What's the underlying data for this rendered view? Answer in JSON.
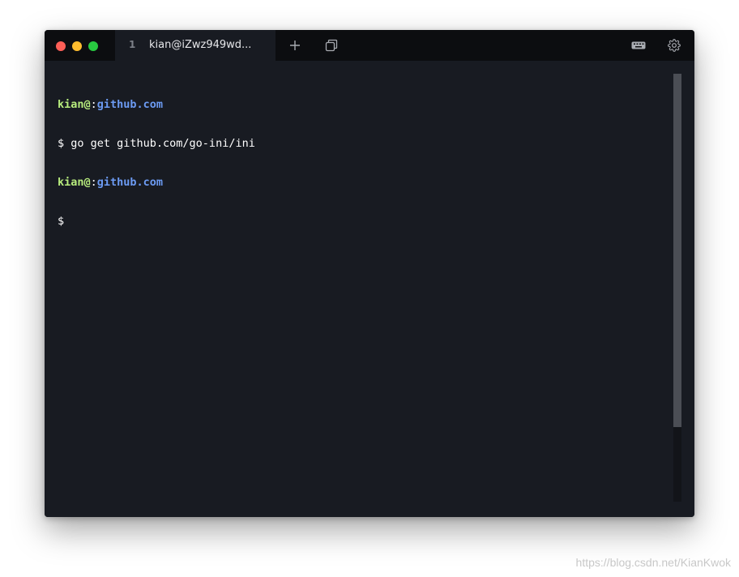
{
  "titlebar": {
    "tab": {
      "index": "1",
      "title": "kian@iZwz949wd..."
    },
    "icons": {
      "new_tab": "plus-icon",
      "windows": "overlapping-windows-icon",
      "keyboard": "keyboard-icon",
      "settings": "gear-icon"
    }
  },
  "terminal": {
    "lines": [
      {
        "user": "kian@",
        "sep": ":",
        "host": "github.com"
      },
      {
        "text": "$ go get github.com/go-ini/ini"
      },
      {
        "user": "kian@",
        "sep": ":",
        "host": "github.com"
      },
      {
        "text": "$"
      }
    ]
  },
  "colors": {
    "background": "#181b22",
    "titlebar": "#0c0d10",
    "user": "#b8ed7e",
    "host": "#6c9bf3",
    "close": "#fe5f57",
    "minimize": "#febc2e",
    "maximize": "#28c840"
  },
  "watermark": "https://blog.csdn.net/KianKwok"
}
